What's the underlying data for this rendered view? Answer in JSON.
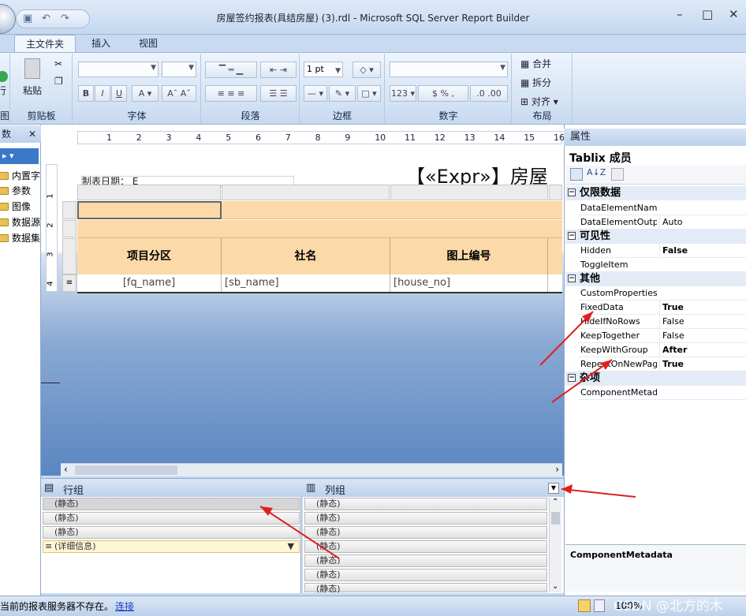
{
  "window": {
    "title": "房屋签约报表(具结房屋)    (3).rdl - Microsoft SQL Server Report Builder"
  },
  "tabs": [
    "主文件夹",
    "插入",
    "视图"
  ],
  "ribbon": {
    "groups": [
      "图",
      "剪贴板",
      "字体",
      "段落",
      "边框",
      "数字",
      "布局"
    ],
    "run_label": "行",
    "paste_label": "粘贴",
    "border_width": "1 pt",
    "layout_merge": "合并",
    "layout_split": "拆分",
    "layout_align": "对齐"
  },
  "left_pane": {
    "title": "数",
    "items": [
      "内置字",
      "参数",
      "图像",
      "数据源",
      "数据集"
    ]
  },
  "ruler_ticks": [
    "1",
    "2",
    "3",
    "4",
    "5",
    "6",
    "7",
    "8",
    "9",
    "10",
    "11",
    "12",
    "13",
    "14",
    "15",
    "16"
  ],
  "vruler_ticks": [
    "1",
    "2",
    "3",
    "4"
  ],
  "report": {
    "date_label": "制表日期： E",
    "title": "【«Expr»】房屋",
    "headers": [
      "项目分区",
      "社名",
      "图上编号"
    ],
    "details": [
      "[fq_name]",
      "[sb_name]",
      "[house_no]"
    ]
  },
  "groups": {
    "row_title": "行组",
    "col_title": "列组",
    "row_items": [
      "(静态)",
      "(静态)",
      "(静态)",
      "(详细信息)"
    ],
    "col_items": [
      "(静态)",
      "(静态)",
      "(静态)",
      "(静态)",
      "(静态)",
      "(静态)",
      "(静态)"
    ]
  },
  "properties": {
    "title": "属性",
    "object": "Tablix 成员",
    "categories": [
      {
        "name": "仅限数据",
        "rows": [
          [
            "DataElementName",
            ""
          ],
          [
            "DataElementOutpu",
            "Auto"
          ]
        ]
      },
      {
        "name": "可见性",
        "rows": [
          [
            "Hidden",
            "False"
          ],
          [
            "ToggleItem",
            ""
          ]
        ]
      },
      {
        "name": "其他",
        "rows": [
          [
            "CustomProperties",
            ""
          ],
          [
            "FixedData",
            "True"
          ],
          [
            "HideIfNoRows",
            "False"
          ],
          [
            "KeepTogether",
            "False"
          ],
          [
            "KeepWithGroup",
            "After"
          ],
          [
            "RepeatOnNewPage",
            "True"
          ]
        ]
      },
      {
        "name": "杂项",
        "rows": [
          [
            "ComponentMetada",
            ""
          ]
        ]
      }
    ],
    "description": "ComponentMetadata"
  },
  "status": {
    "message": "当前的报表服务器不存在。",
    "link": "连接",
    "zoom": "100%",
    "watermark": "CSDN @北方的木"
  },
  "colors": {
    "header_fill": "#fbd9a8",
    "annotation": "#e02020"
  }
}
